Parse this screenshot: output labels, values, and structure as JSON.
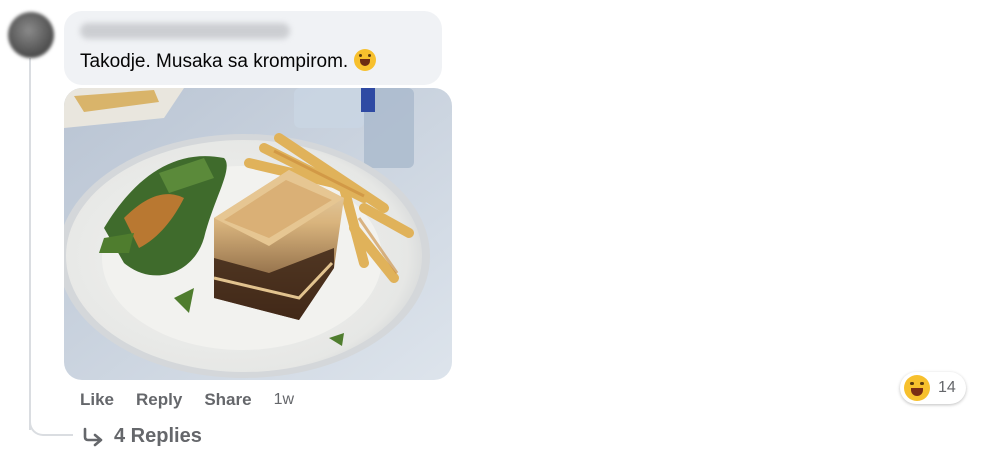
{
  "comment": {
    "text": "Takodje. Musaka sa krompirom.",
    "emoji": "laughing-face-emoji",
    "attachment": "photo"
  },
  "actions": {
    "like": "Like",
    "reply": "Reply",
    "share": "Share",
    "time": "1w"
  },
  "reaction": {
    "emoji": "laughing-face",
    "count": "14"
  },
  "replies": {
    "label": "4 Replies",
    "icon": "reply-arrow-icon"
  },
  "colors": {
    "bubble": "#f0f2f5",
    "secondary_text": "#65676b",
    "emoji": "#f7c02d"
  }
}
